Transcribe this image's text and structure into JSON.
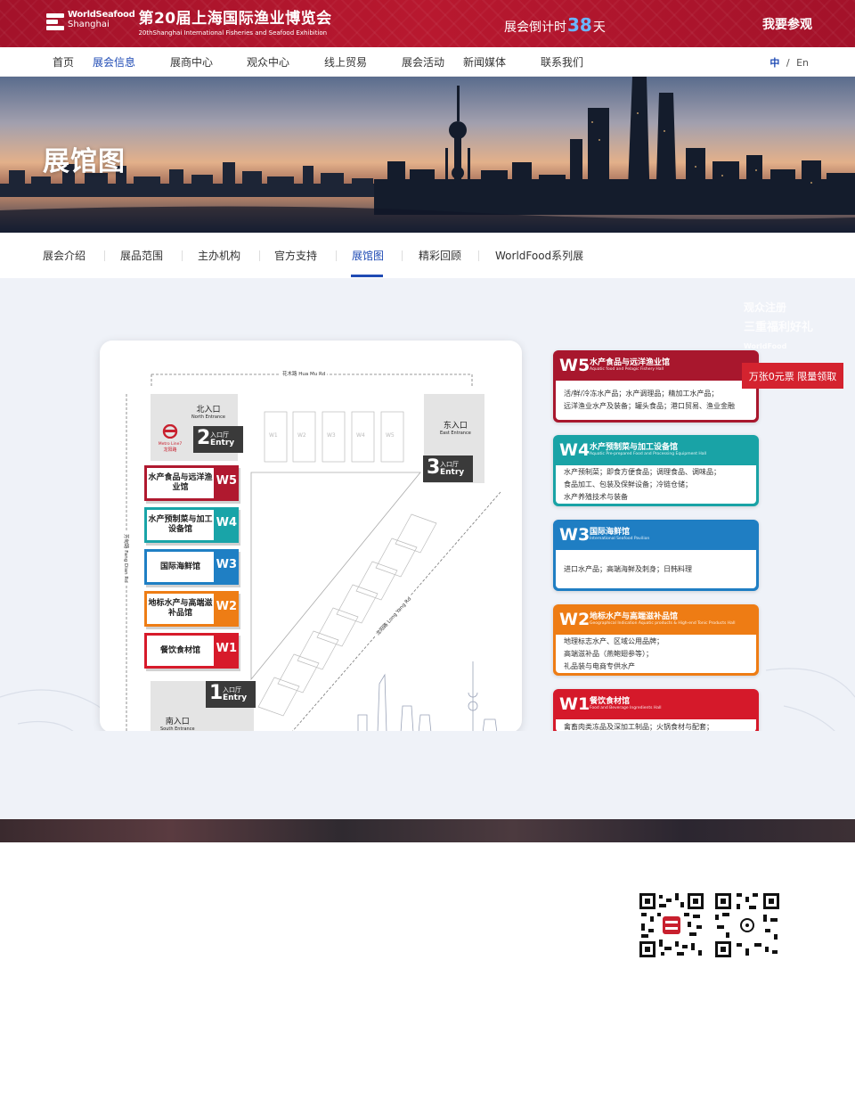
{
  "header": {
    "brand_line1": "WorldSeafood",
    "brand_line2": "Shanghai",
    "title": "第20届上海国际渔业博览会",
    "subtitle": "20thShanghai International Fisheries and Seafood Exhibition",
    "countdown_prefix": "展会倒计时",
    "countdown_days": "38",
    "countdown_suffix": "天",
    "visit_button": "我要参观"
  },
  "main_nav": {
    "items": [
      "首页",
      "展会信息",
      "展商中心",
      "观众中心",
      "线上贸易",
      "展会活动",
      "新闻媒体",
      "联系我们"
    ],
    "active": "展会信息",
    "lang_current": "中",
    "lang_sep": "/",
    "lang_other": "En"
  },
  "hero": {
    "title": "展馆图"
  },
  "sub_nav": {
    "items": [
      "展会介绍",
      "展品范围",
      "主办机构",
      "官方支持",
      "展馆图",
      "精彩回顾",
      "WorldFood系列展"
    ],
    "active": "展馆图"
  },
  "floor_map": {
    "roads": {
      "north": "花木路 Hua Mu Rd",
      "west": "芳甸路 Fang Dian Rd",
      "diagonal": "龙阳路 Long Yang Rd"
    },
    "entrances": [
      {
        "cn": "北入口",
        "en": "North Entrance"
      },
      {
        "cn": "东入口",
        "en": "East Entrance"
      },
      {
        "cn": "南入口",
        "en": "South Entrance"
      }
    ],
    "entry_halls": [
      {
        "num": "2",
        "cn": "入口厅",
        "en": "Entry"
      },
      {
        "num": "3",
        "cn": "入口厅",
        "en": "Entry"
      },
      {
        "num": "1",
        "cn": "入口厅",
        "en": "Entry"
      }
    ],
    "metro_label_cn": "龙阳路",
    "metro_label_en": "Metro Line7",
    "north_halls": [
      "W1",
      "W2",
      "W3",
      "W4",
      "W5"
    ],
    "halls": [
      {
        "code": "W5",
        "name": "水产食品与远洋渔业馆",
        "color": "#b0192f"
      },
      {
        "code": "W4",
        "name": "水产预制菜与加工设备馆",
        "color": "#19a4a8"
      },
      {
        "code": "W3",
        "name": "国际海鲜馆",
        "color": "#1f7fc4"
      },
      {
        "code": "W2",
        "name": "地标水产与高端滋补品馆",
        "color": "#ee7d15"
      },
      {
        "code": "W1",
        "name": "餐饮食材馆",
        "color": "#d71a2a"
      }
    ]
  },
  "hall_cards": [
    {
      "code": "W5",
      "title": "水产食品与远洋渔业馆",
      "subtitle": "Aquatic food and Pelagic Fishery Hall",
      "color": "#a8172d",
      "lines": [
        "活/鲜/冷冻水产品；水产调理品；精加工水产品；",
        "远洋渔业水产及装备；罐头食品；港口贸易、渔业金融"
      ]
    },
    {
      "code": "W4",
      "title": "水产预制菜与加工设备馆",
      "subtitle": "Aquatic Pre-prepared Food and Processing Equipment Hall",
      "color": "#19a3a6",
      "lines": [
        "水产预制菜；即食方便食品；调理食品、调味品；",
        "食品加工、包装及保鲜设备；冷链仓储；",
        "水产养殖技术与装备"
      ]
    },
    {
      "code": "W3",
      "title": "国际海鲜馆",
      "subtitle": "International Seafood Pavilion",
      "color": "#1f7ec3",
      "lines": [
        "进口水产品；高端海鲜及刺身；日韩料理"
      ]
    },
    {
      "code": "W2",
      "title": "地标水产与高端滋补品馆",
      "subtitle": "Geographical Indication Aquatic products & High-end Tonic Products Hall",
      "color": "#ee7c14",
      "lines": [
        "地理标志水产、区域公用品牌；",
        "高端滋补品（燕鲍翅参等）；",
        "礼品装与电商专供水产"
      ]
    },
    {
      "code": "W1",
      "title": "餐饮食材馆",
      "subtitle": "Food and Beverage Ingredients Hall",
      "color": "#d5192a",
      "lines": [
        "禽畜肉类冻品及深加工制品；火锅食材与配套；"
      ]
    }
  ],
  "promo": {
    "button": "万张0元票 限量领取",
    "ghost_line1": "观众注册",
    "ghost_line2": "三重福利好礼",
    "ghost_line3": "WorldFood"
  }
}
